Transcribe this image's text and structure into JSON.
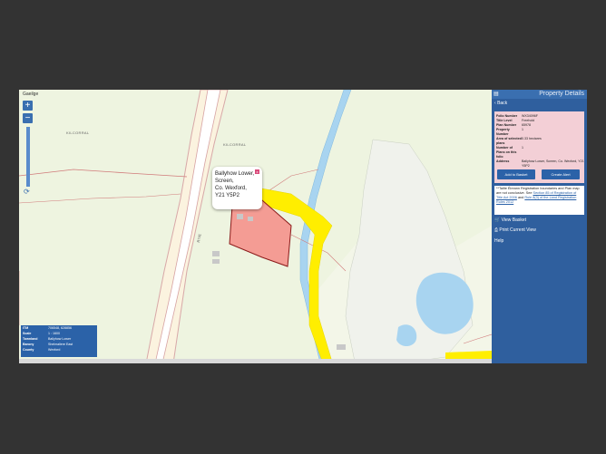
{
  "map": {
    "language_link": "Gaeilge",
    "zoom_in": "+",
    "zoom_out": "−",
    "townland_label_1": "KILCORRAL",
    "townland_label_2": "KILCORRAL",
    "road_label": "R741",
    "popup": {
      "line1": "Ballyhow Lower,",
      "line2": "Screen,",
      "line3": "Co. Wexford,",
      "line4": "Y21 Y5P2",
      "close": "x"
    },
    "info": [
      {
        "key": "ITM",
        "value": "706548, 628856"
      },
      {
        "key": "Scale",
        "value": "1 : 1600"
      },
      {
        "key": "Townland",
        "value": "Ballyhow Lower"
      },
      {
        "key": "Barony",
        "value": "Shelmalierе East"
      },
      {
        "key": "County",
        "value": "Wexford"
      }
    ],
    "colors": {
      "parcel_fill": "#f4928c",
      "parcel_stroke": "#8b1a1a",
      "highlight": "#ffee00",
      "river": "#a8d4f0",
      "boundary": "#d07a7a"
    }
  },
  "panel": {
    "title": "Property Details",
    "back": "Back",
    "details": [
      {
        "key": "Folio Number",
        "value": "WX34096F"
      },
      {
        "key": "Title Level",
        "value": "Freehold"
      },
      {
        "key": "Plan Number",
        "value": "65978"
      },
      {
        "key": "Property Number",
        "value": "1"
      },
      {
        "key": "Area of selected plans",
        "value": "0.33 hectares"
      },
      {
        "key": "Number of Plans on this folio",
        "value": "1"
      },
      {
        "key": "Address",
        "value": "Ballyhow Lower, Screen, Co. Wexford, Y21 Y5P2"
      }
    ],
    "add_to_basket": "Add to Basket",
    "create_alert": "Create Alert",
    "note": {
      "text1": "**Tailte Éireann Registration boundaries and Plan",
      "text2": "map are not conclusive. See",
      "link1": "Section 85 of Registration of Title Act 2006",
      "text3": "and",
      "link2": "Rule 8(3) of the Land Registration Rules 2012"
    },
    "view_basket": "View Basket",
    "print_view": "Print Current View",
    "help": "Help"
  }
}
